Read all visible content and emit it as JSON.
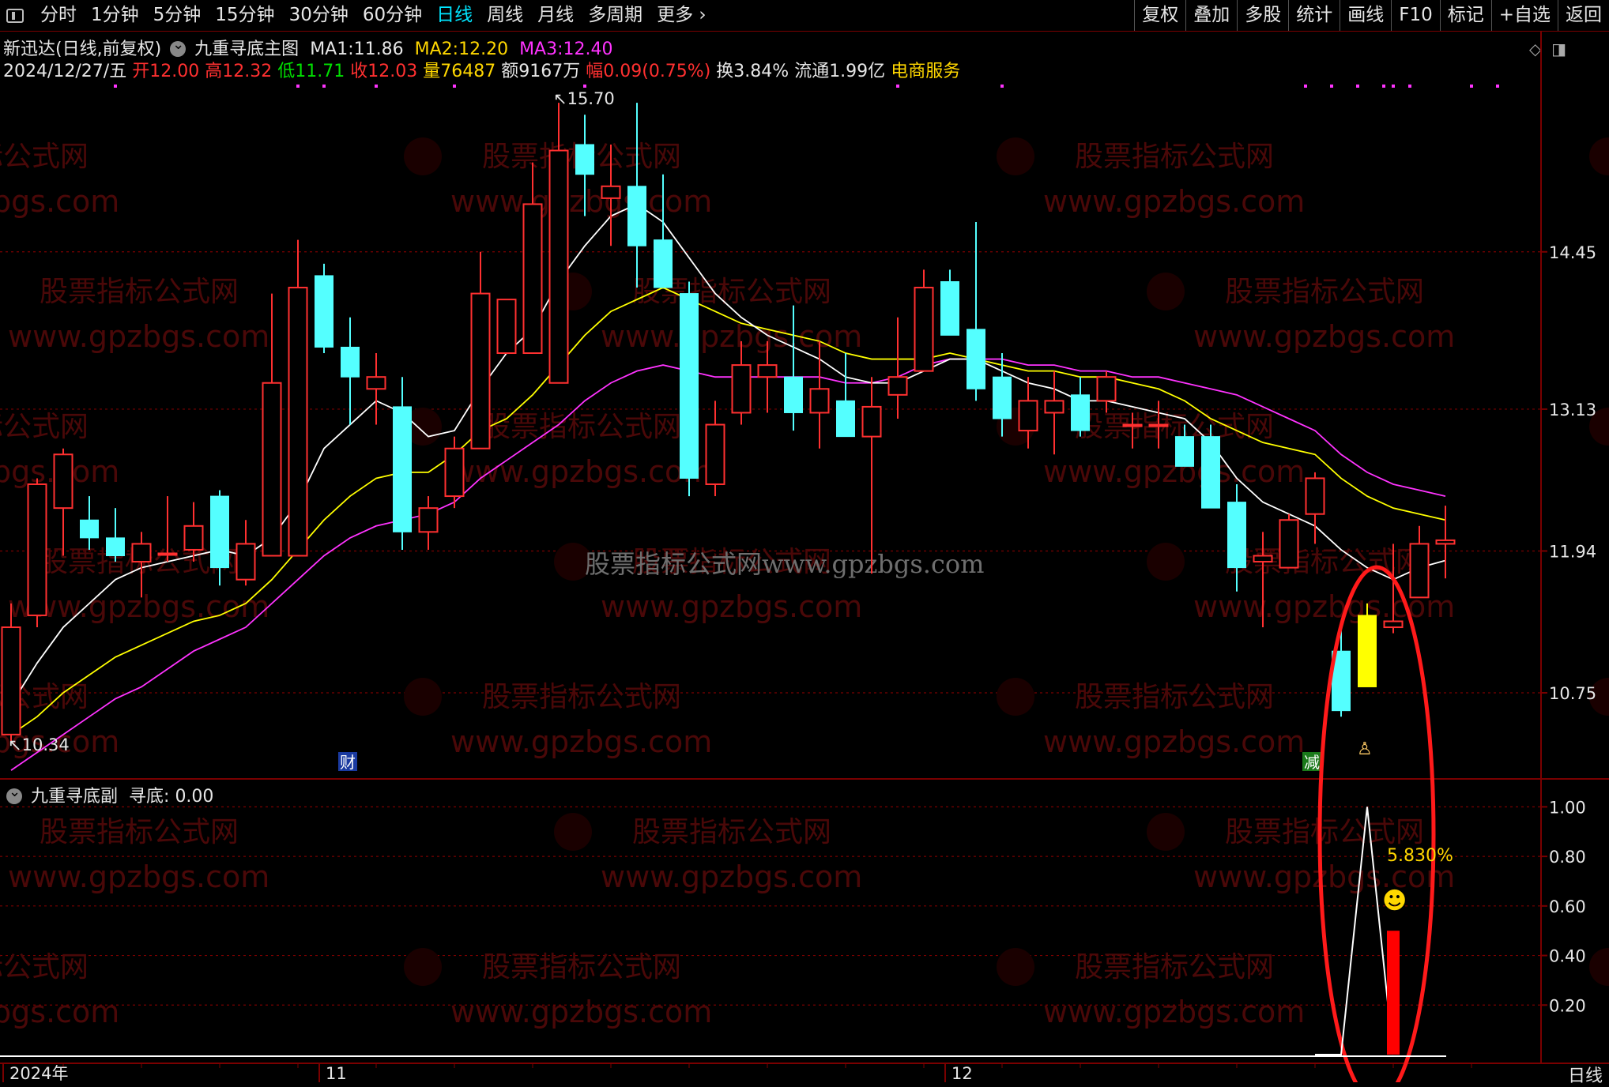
{
  "toolbar": {
    "periods": [
      "分时",
      "1分钟",
      "5分钟",
      "15分钟",
      "30分钟",
      "60分钟",
      "日线",
      "周线",
      "月线",
      "多周期",
      "更多"
    ],
    "active": "日线",
    "right_buttons": [
      "复权",
      "叠加",
      "多股",
      "统计",
      "画线",
      "F10",
      "标记",
      "+自选",
      "返回"
    ]
  },
  "header": {
    "stock": "新迅达(日线,前复权)",
    "indicator": "九重寻底主图",
    "ma1_label": "MA1:",
    "ma1_value": "11.86",
    "ma2_label": "MA2:",
    "ma2_value": "12.20",
    "ma3_label": "MA3:",
    "ma3_value": "12.40",
    "date": "2024/12/27/五",
    "open_label": "开",
    "open": "12.00",
    "high_label": "高",
    "high": "12.32",
    "low_label": "低",
    "low": "11.71",
    "close_label": "收",
    "close": "12.03",
    "vol_label": "量",
    "vol": "76487",
    "amount": "额9167万",
    "change_label": "幅",
    "change": "0.09(0.75%)",
    "turnover": "换3.84%",
    "float": "流通1.99亿",
    "sector": "电商服务"
  },
  "main_chart": {
    "price_axis": [
      "14.45",
      "13.13",
      "11.94",
      "10.75"
    ],
    "high_marker": "15.70",
    "low_marker": "10.34",
    "event_markers": [
      "财",
      "减"
    ]
  },
  "sub_chart": {
    "name": "九重寻底副",
    "value_label": "寻底:",
    "value": "0.00",
    "axis": [
      "1.00",
      "0.80",
      "0.60",
      "0.40",
      "0.20"
    ],
    "annotation": "5.830%"
  },
  "time_axis": [
    "2024年",
    "11",
    "12"
  ],
  "status": {
    "period": "日线"
  },
  "watermark": {
    "site": "股票指标公式网",
    "url": "www.gpzbgs.com",
    "center": "股票指标公式网www.gpzbgs.com"
  },
  "colors": {
    "up": "#ff3030",
    "down": "#54ffff",
    "ma1": "#ffffff",
    "ma2": "#ffff00",
    "ma3": "#ff33ff",
    "grid": "#7a0000"
  },
  "chart_data": {
    "type": "candlestick",
    "ylim": [
      10.2,
      15.9
    ],
    "candles": [
      {
        "o": 10.4,
        "h": 11.5,
        "l": 10.34,
        "c": 11.3
      },
      {
        "o": 11.4,
        "h": 12.55,
        "l": 11.3,
        "c": 12.5
      },
      {
        "o": 12.3,
        "h": 12.8,
        "l": 11.9,
        "c": 12.75
      },
      {
        "o": 12.2,
        "h": 12.4,
        "l": 11.95,
        "c": 12.05
      },
      {
        "o": 12.05,
        "h": 12.3,
        "l": 11.85,
        "c": 11.9
      },
      {
        "o": 11.85,
        "h": 12.1,
        "l": 11.55,
        "c": 12.0
      },
      {
        "o": 11.92,
        "h": 12.4,
        "l": 11.85,
        "c": 11.92
      },
      {
        "o": 11.95,
        "h": 12.35,
        "l": 11.85,
        "c": 12.15
      },
      {
        "o": 12.4,
        "h": 12.45,
        "l": 11.65,
        "c": 11.8
      },
      {
        "o": 11.7,
        "h": 12.2,
        "l": 11.65,
        "c": 12.0
      },
      {
        "o": 11.9,
        "h": 14.1,
        "l": 11.9,
        "c": 13.35
      },
      {
        "o": 11.9,
        "h": 14.55,
        "l": 11.9,
        "c": 14.15
      },
      {
        "o": 14.25,
        "h": 14.35,
        "l": 13.6,
        "c": 13.65
      },
      {
        "o": 13.65,
        "h": 13.9,
        "l": 13.0,
        "c": 13.4
      },
      {
        "o": 13.3,
        "h": 13.6,
        "l": 13.0,
        "c": 13.4
      },
      {
        "o": 13.15,
        "h": 13.4,
        "l": 11.95,
        "c": 12.1
      },
      {
        "o": 12.1,
        "h": 12.4,
        "l": 11.95,
        "c": 12.3
      },
      {
        "o": 12.4,
        "h": 12.9,
        "l": 12.3,
        "c": 12.8
      },
      {
        "o": 12.8,
        "h": 14.45,
        "l": 12.8,
        "c": 14.1
      },
      {
        "o": 13.6,
        "h": 14.0,
        "l": 13.6,
        "c": 14.05
      },
      {
        "o": 13.6,
        "h": 15.2,
        "l": 13.6,
        "c": 14.85
      },
      {
        "o": 13.35,
        "h": 15.7,
        "l": 13.35,
        "c": 15.3
      },
      {
        "o": 15.35,
        "h": 15.6,
        "l": 14.75,
        "c": 15.1
      },
      {
        "o": 14.9,
        "h": 15.35,
        "l": 14.5,
        "c": 15.0
      },
      {
        "o": 15.0,
        "h": 15.7,
        "l": 14.15,
        "c": 14.5
      },
      {
        "o": 14.55,
        "h": 15.1,
        "l": 14.25,
        "c": 14.15
      },
      {
        "o": 14.1,
        "h": 14.2,
        "l": 12.4,
        "c": 12.55
      },
      {
        "o": 12.5,
        "h": 13.2,
        "l": 12.4,
        "c": 13.0
      },
      {
        "o": 13.1,
        "h": 13.7,
        "l": 13.0,
        "c": 13.5
      },
      {
        "o": 13.4,
        "h": 13.7,
        "l": 13.1,
        "c": 13.5
      },
      {
        "o": 13.4,
        "h": 14.0,
        "l": 12.95,
        "c": 13.1
      },
      {
        "o": 13.1,
        "h": 13.7,
        "l": 12.8,
        "c": 13.3
      },
      {
        "o": 13.2,
        "h": 13.6,
        "l": 12.95,
        "c": 12.9
      },
      {
        "o": 12.9,
        "h": 13.4,
        "l": 11.75,
        "c": 13.15
      },
      {
        "o": 13.25,
        "h": 13.9,
        "l": 13.05,
        "c": 13.4
      },
      {
        "o": 13.45,
        "h": 14.3,
        "l": 13.45,
        "c": 14.15
      },
      {
        "o": 14.2,
        "h": 14.3,
        "l": 13.8,
        "c": 13.75
      },
      {
        "o": 13.8,
        "h": 14.7,
        "l": 13.2,
        "c": 13.3
      },
      {
        "o": 13.4,
        "h": 13.6,
        "l": 12.9,
        "c": 13.05
      },
      {
        "o": 12.95,
        "h": 13.4,
        "l": 12.8,
        "c": 13.2
      },
      {
        "o": 13.1,
        "h": 13.45,
        "l": 12.75,
        "c": 13.2
      },
      {
        "o": 13.25,
        "h": 13.4,
        "l": 12.9,
        "c": 12.95
      },
      {
        "o": 13.2,
        "h": 13.45,
        "l": 13.1,
        "c": 13.4
      },
      {
        "o": 13.0,
        "h": 13.1,
        "l": 12.8,
        "c": 13.0
      },
      {
        "o": 13.0,
        "h": 13.2,
        "l": 12.8,
        "c": 13.0
      },
      {
        "o": 12.9,
        "h": 13.0,
        "l": 12.65,
        "c": 12.65
      },
      {
        "o": 12.9,
        "h": 13.0,
        "l": 12.3,
        "c": 12.3
      },
      {
        "o": 12.35,
        "h": 12.5,
        "l": 11.6,
        "c": 11.8
      },
      {
        "o": 11.85,
        "h": 12.1,
        "l": 11.3,
        "c": 11.9
      },
      {
        "o": 11.8,
        "h": 12.25,
        "l": 11.8,
        "c": 12.2
      },
      {
        "o": 12.25,
        "h": 12.6,
        "l": 12.0,
        "c": 12.55
      },
      {
        "o": 11.1,
        "h": 11.35,
        "l": 10.55,
        "c": 10.6
      },
      {
        "o": 10.8,
        "h": 11.5,
        "l": 10.8,
        "c": 11.4
      },
      {
        "o": 11.3,
        "h": 12.0,
        "l": 11.25,
        "c": 11.35
      },
      {
        "o": 11.55,
        "h": 12.15,
        "l": 11.55,
        "c": 12.0
      },
      {
        "o": 12.0,
        "h": 12.32,
        "l": 11.71,
        "c": 12.03
      }
    ],
    "ma1": [
      10.65,
      11.0,
      11.3,
      11.5,
      11.7,
      11.8,
      11.85,
      11.9,
      11.95,
      11.9,
      12.05,
      12.35,
      12.8,
      13.0,
      13.2,
      13.1,
      12.9,
      12.95,
      13.3,
      13.6,
      13.8,
      14.2,
      14.5,
      14.75,
      14.85,
      14.7,
      14.4,
      14.1,
      13.9,
      13.75,
      13.65,
      13.55,
      13.4,
      13.35,
      13.35,
      13.45,
      13.55,
      13.55,
      13.45,
      13.35,
      13.3,
      13.2,
      13.2,
      13.15,
      13.1,
      13.05,
      12.85,
      12.55,
      12.35,
      12.25,
      12.15,
      11.95,
      11.8,
      11.7,
      11.8,
      11.86
    ],
    "ma2": [
      10.4,
      10.55,
      10.75,
      10.9,
      11.05,
      11.15,
      11.25,
      11.35,
      11.4,
      11.5,
      11.7,
      11.95,
      12.2,
      12.4,
      12.55,
      12.6,
      12.6,
      12.75,
      12.95,
      13.05,
      13.25,
      13.5,
      13.75,
      13.95,
      14.05,
      14.15,
      14.05,
      13.95,
      13.85,
      13.8,
      13.75,
      13.7,
      13.6,
      13.55,
      13.55,
      13.55,
      13.6,
      13.55,
      13.5,
      13.45,
      13.45,
      13.4,
      13.4,
      13.35,
      13.3,
      13.2,
      13.05,
      12.95,
      12.85,
      12.8,
      12.75,
      12.55,
      12.4,
      12.3,
      12.25,
      12.2
    ],
    "ma3": [
      10.1,
      10.25,
      10.4,
      10.55,
      10.7,
      10.8,
      10.95,
      11.1,
      11.2,
      11.3,
      11.5,
      11.7,
      11.9,
      12.05,
      12.15,
      12.2,
      12.25,
      12.35,
      12.55,
      12.7,
      12.85,
      13.0,
      13.2,
      13.35,
      13.45,
      13.5,
      13.45,
      13.4,
      13.4,
      13.4,
      13.4,
      13.4,
      13.35,
      13.35,
      13.4,
      13.5,
      13.55,
      13.55,
      13.55,
      13.5,
      13.5,
      13.45,
      13.45,
      13.4,
      13.4,
      13.35,
      13.3,
      13.25,
      13.15,
      13.05,
      12.95,
      12.75,
      12.6,
      12.5,
      12.45,
      12.4
    ],
    "sub_line": {
      "indices": [
        50,
        51,
        52,
        53
      ],
      "values": [
        0,
        0,
        1.0,
        0
      ]
    },
    "sub_bar": {
      "index": 53,
      "value": 0.5
    },
    "sub_ylim": [
      0,
      1.1
    ]
  }
}
